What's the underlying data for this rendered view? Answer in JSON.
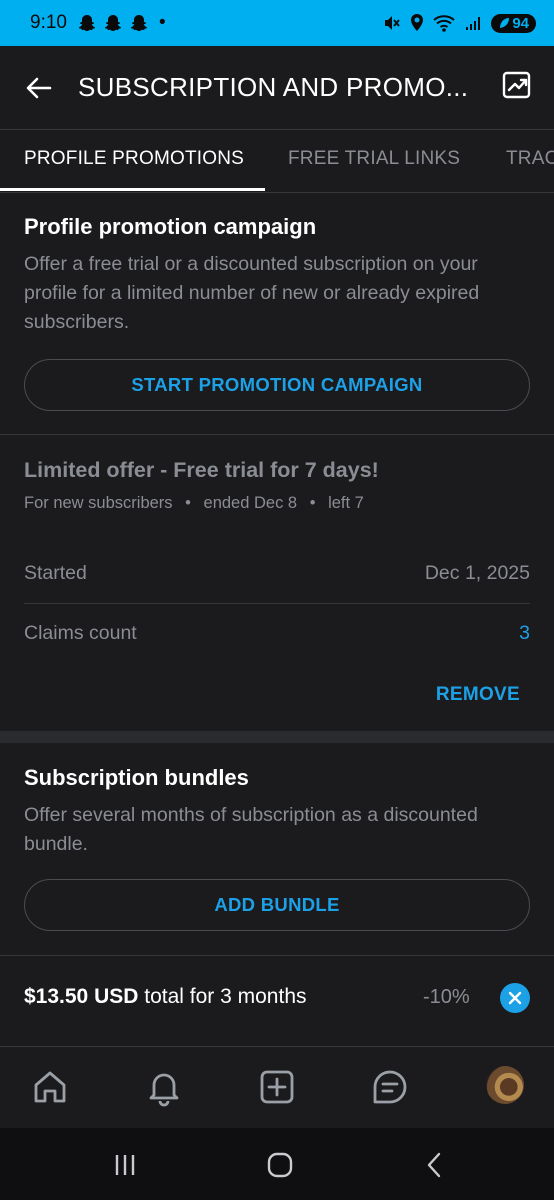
{
  "status_bar": {
    "time": "9:10",
    "dot": "•",
    "battery": "94",
    "icons": [
      "snapchat-icon",
      "snapchat-icon",
      "snapchat-icon",
      "mute-icon",
      "location-icon",
      "wifi-icon",
      "signal-icon",
      "battery-icon"
    ]
  },
  "header": {
    "title": "SUBSCRIPTION AND PROMO...",
    "back_icon": "arrow-left-icon",
    "stats_icon": "chart-icon"
  },
  "tabs": [
    {
      "label": "PROFILE PROMOTIONS",
      "active": true
    },
    {
      "label": "FREE TRIAL LINKS",
      "active": false
    },
    {
      "label": "TRAC",
      "active": false
    }
  ],
  "promotion_section": {
    "title": "Profile promotion campaign",
    "description": "Offer a free trial or a discounted subscription on your profile for a limited number of new or already expired subscribers.",
    "button_label": "START PROMOTION CAMPAIGN"
  },
  "campaign": {
    "title": "Limited offer - Free trial for 7 days!",
    "audience": "For new subscribers",
    "ended": "ended Dec 8",
    "left": "left 7",
    "separator": "•",
    "started_label": "Started",
    "started_value": "Dec 1, 2025",
    "claims_label": "Claims count",
    "claims_value": "3",
    "remove_label": "REMOVE"
  },
  "bundles_section": {
    "title": "Subscription bundles",
    "description": "Offer several months of subscription as a discounted bundle.",
    "button_label": "ADD BUNDLE"
  },
  "bundle": {
    "price": "$13.50 USD",
    "period": "total for 3 months",
    "discount": "-10%"
  },
  "bottom_nav": [
    "home-icon",
    "notifications-icon",
    "add-post-icon",
    "messages-icon",
    "profile-avatar"
  ],
  "colors": {
    "accent": "#00aff0",
    "link": "#1da1e6",
    "background": "#1b1b1e",
    "muted_text": "#8a8d93"
  }
}
